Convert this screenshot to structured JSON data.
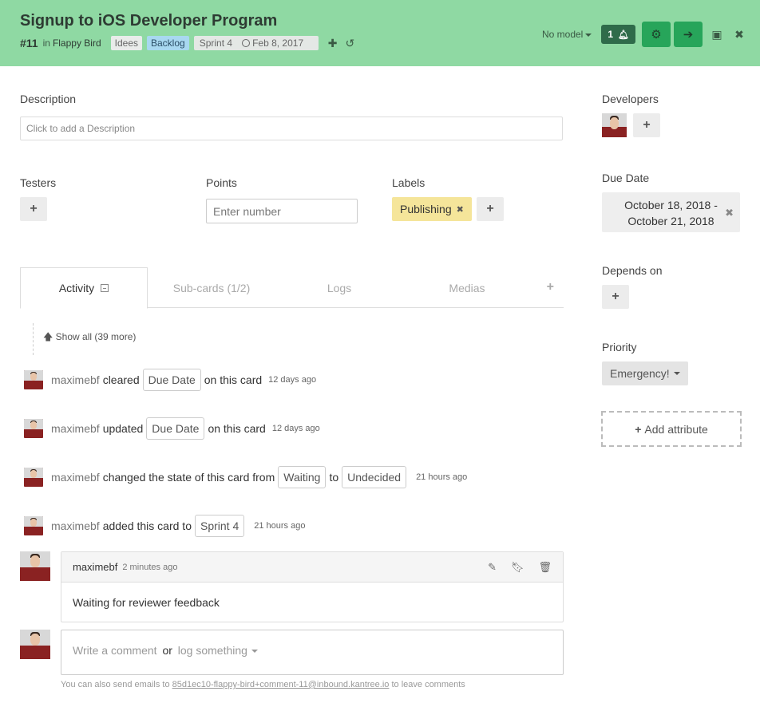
{
  "header": {
    "title": "Signup to iOS Developer Program",
    "card_number": "#11",
    "in_text": "in",
    "project": "Flappy Bird",
    "tags": [
      "Idees",
      "Backlog"
    ],
    "sprint": "Sprint 4",
    "date": "Feb 8, 2017",
    "model_select": "No model",
    "notification_count": "1",
    "colors": {
      "header_bg": "#8fd9a3",
      "button_green": "#27a55a",
      "notif_dark": "#2f6b4a"
    }
  },
  "description": {
    "label": "Description",
    "placeholder": "Click to add a Description"
  },
  "testers": {
    "label": "Testers"
  },
  "points": {
    "label": "Points",
    "placeholder": "Enter number"
  },
  "labels": {
    "label": "Labels",
    "items": [
      "Publishing"
    ]
  },
  "tabs": {
    "activity": "Activity",
    "subcards": "Sub-cards (1/2)",
    "logs": "Logs",
    "medias": "Medias"
  },
  "activity": {
    "show_all": "Show all (39 more)",
    "items": [
      {
        "user": "maximebf",
        "verb": "cleared",
        "chip": "Due Date",
        "rest": "on this card",
        "time": "12 days ago"
      },
      {
        "user": "maximebf",
        "verb": "updated",
        "chip": "Due Date",
        "rest": "on this card",
        "time": "12 days ago"
      },
      {
        "user": "maximebf",
        "verb": "changed the state of this card from",
        "chip": "Waiting",
        "to": "to",
        "chip2": "Undecided",
        "time": "21 hours ago"
      },
      {
        "user": "maximebf",
        "verb": "added this card to",
        "chip": "Sprint 4",
        "time": "21 hours ago"
      }
    ]
  },
  "comment": {
    "user": "maximebf",
    "time": "2 minutes ago",
    "body": "Waiting for reviewer feedback"
  },
  "composer": {
    "write": "Write a comment",
    "or": "or",
    "log": "log something",
    "hint_prefix": "You can also send emails to",
    "hint_email": "85d1ec10-flappy-bird+comment-11@inbound.kantree.io",
    "hint_suffix": "to leave comments"
  },
  "sidebar": {
    "developers_label": "Developers",
    "due_date_label": "Due Date",
    "due_date_line1": "October 18, 2018 -",
    "due_date_line2": "October 21, 2018",
    "depends_label": "Depends on",
    "priority_label": "Priority",
    "priority_value": "Emergency!",
    "add_attribute": "Add attribute"
  }
}
